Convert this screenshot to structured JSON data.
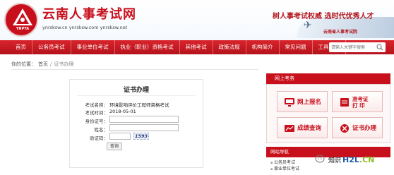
{
  "header": {
    "logo_text": "YNPTA",
    "title": "云南人事考试网",
    "url": "ynrsksw.cn ynrsksw.com ynrsksw.net",
    "slogan": "树人事考试权威 选时代优秀人才",
    "sub_logo": "云南省人事考试院"
  },
  "nav": {
    "items": [
      {
        "label": "首页"
      },
      {
        "label": "公务员考试"
      },
      {
        "label": "事业单位考试"
      },
      {
        "label": "执业（职业）资格考试"
      },
      {
        "label": "其他考试"
      },
      {
        "label": "政策法规"
      },
      {
        "label": "机构简介"
      },
      {
        "label": "常见问题"
      },
      {
        "label": "工具下载"
      }
    ],
    "search_placeholder": "请输入关键字搜索"
  },
  "breadcrumb": {
    "prefix": "你的位置：",
    "home": "首页",
    "sep": "/",
    "current": "证书办理"
  },
  "form": {
    "title": "证书办理",
    "exam_name_label": "考试名称：",
    "exam_name_value": "环境影响评价工程师资格考试",
    "exam_time_label": "考试时间：",
    "exam_time_value": "2018-05-01",
    "id_label": "身份证号：",
    "name_label": "姓名：",
    "captcha_label": "验证码：",
    "captcha_value": "1593",
    "query_label": "查询"
  },
  "sidebar": {
    "online_service_title": "网上考务",
    "services": [
      {
        "label": "网上报名",
        "icon": "monitor-icon"
      },
      {
        "label1": "准考证",
        "label2": "打 印",
        "icon": "ticket-icon"
      },
      {
        "label": "成绩查询",
        "icon": "chart-icon"
      },
      {
        "label": "证书办理",
        "icon": "certificate-icon"
      }
    ],
    "site_nav_title": "网站导航",
    "site_nav_items": [
      "公务员考试",
      "事业单位考试"
    ]
  },
  "watermark": {
    "text": "知识",
    "brand": "H2L",
    "brand_suffix": ".CN"
  },
  "colors": {
    "brand_red": "#c8101c",
    "nav_red": "#d8242c"
  }
}
